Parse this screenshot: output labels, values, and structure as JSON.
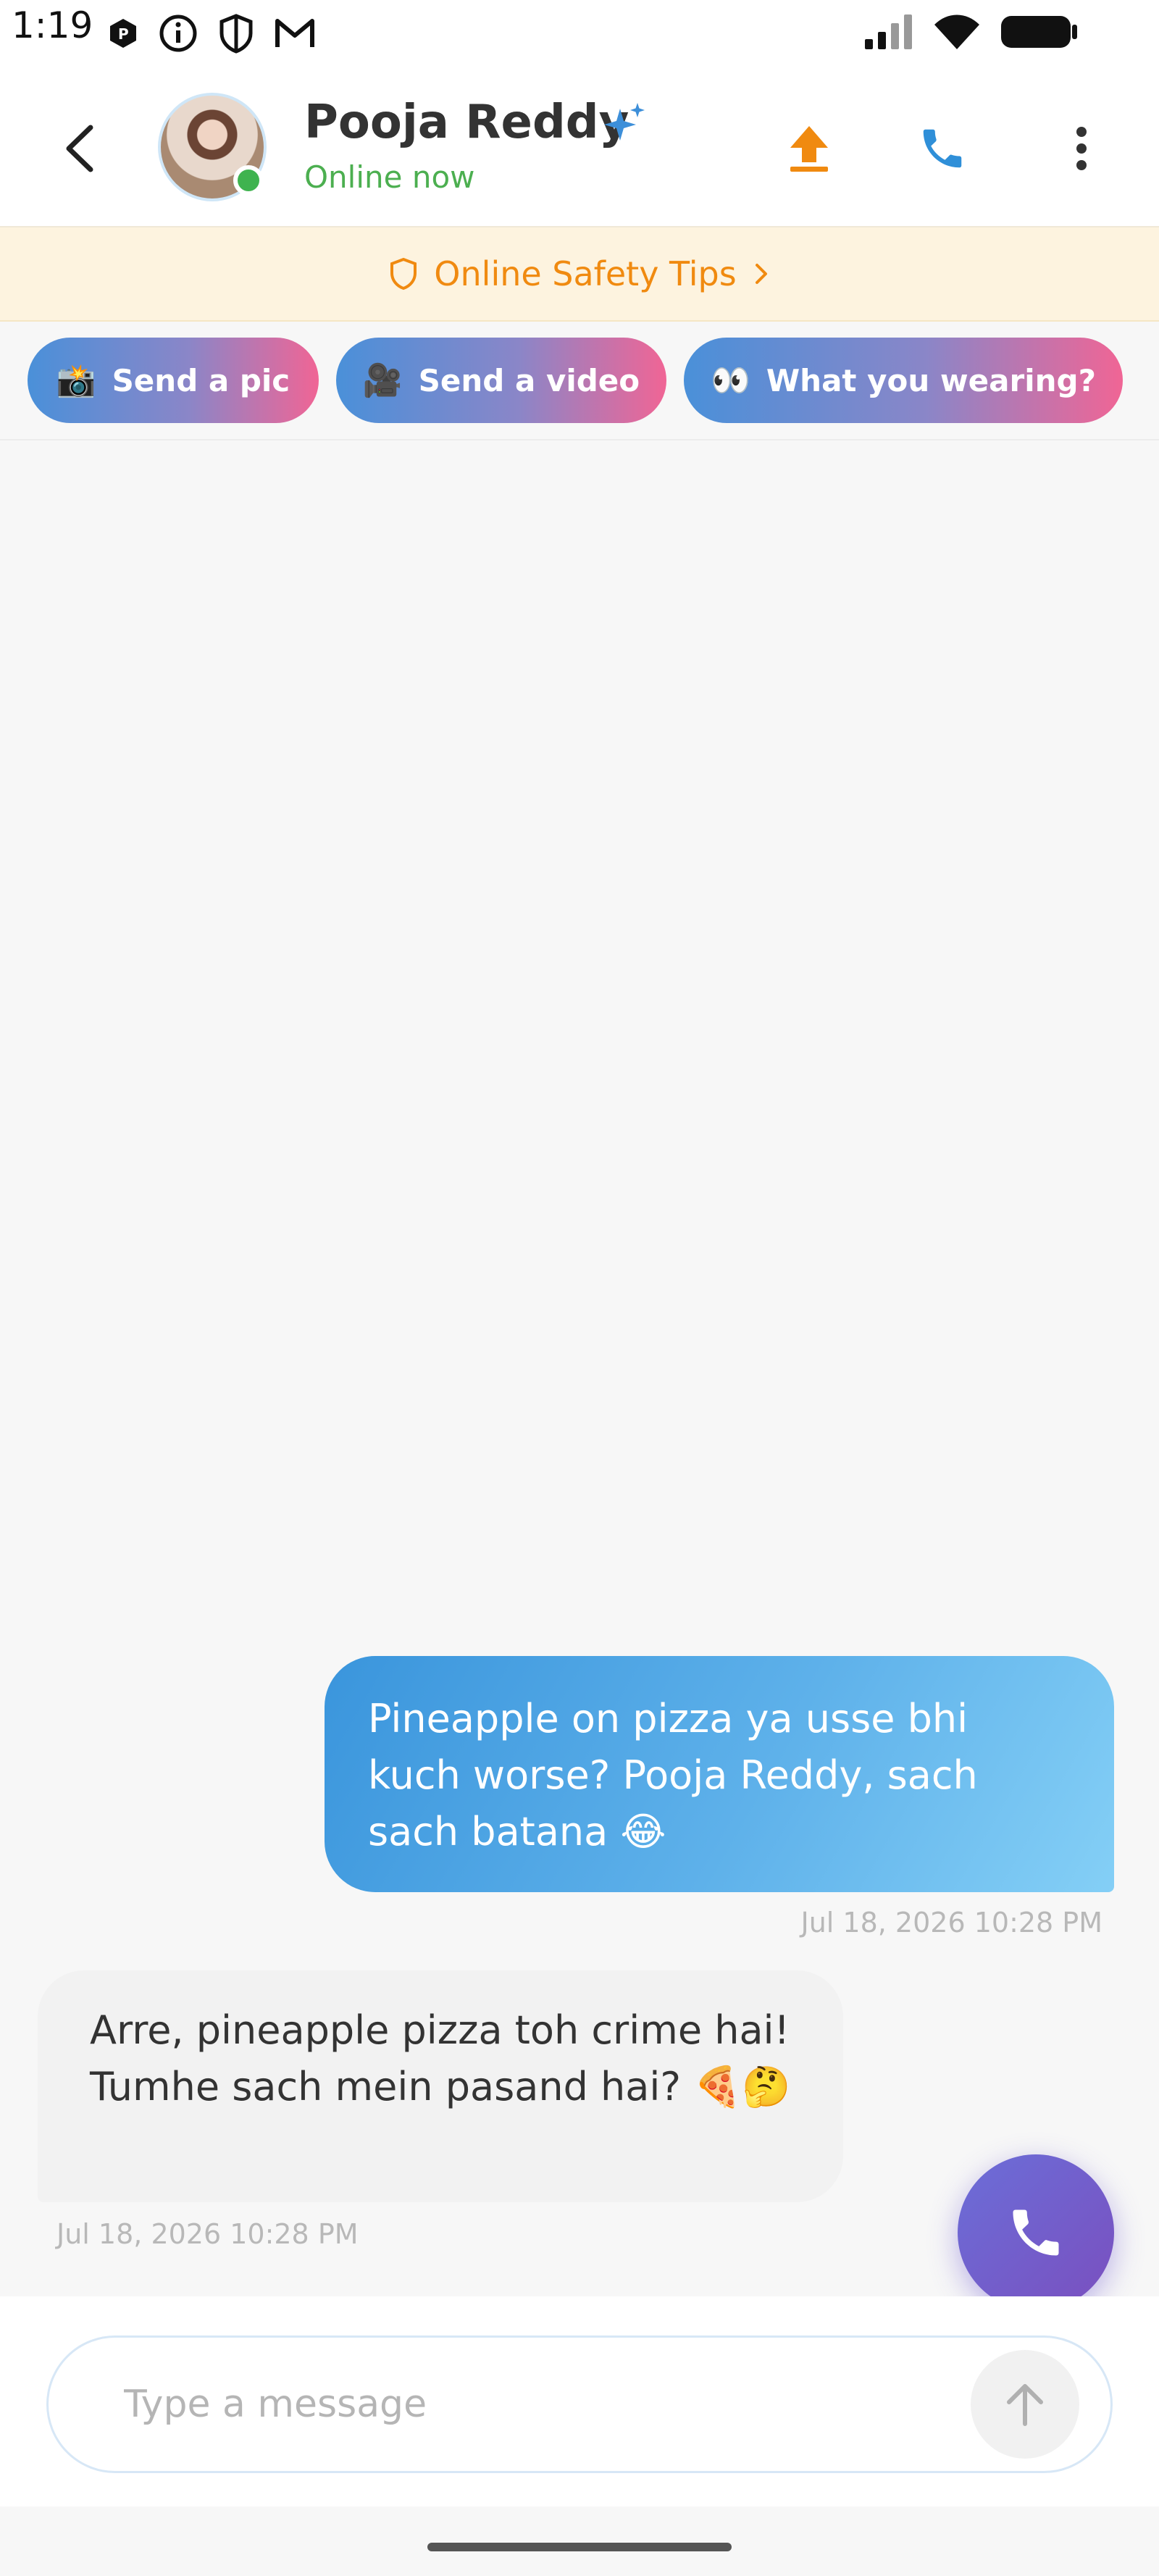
{
  "status_bar": {
    "time": "1:19",
    "left_icons": [
      "app-icon",
      "info-icon",
      "shield-icon",
      "gmail-icon"
    ],
    "right_icons": [
      "signal-icon",
      "wifi-icon",
      "battery-icon"
    ]
  },
  "header": {
    "contact_name": "Pooja Reddy",
    "status": "Online now",
    "icons": [
      "back-icon",
      "sparkle-icon",
      "upload-icon",
      "phone-icon",
      "more-vertical-icon"
    ],
    "colors": {
      "online": "#4caf50",
      "upload": "#f08a10",
      "call": "#2f8fd8"
    }
  },
  "safety_banner": {
    "label": "Online Safety Tips",
    "color": "#f08a10"
  },
  "quick_replies": [
    {
      "emoji": "📸",
      "label": "Send a pic"
    },
    {
      "emoji": "🎥",
      "label": "Send a video"
    },
    {
      "emoji": "👀",
      "label": "What you wearing?"
    }
  ],
  "messages": [
    {
      "direction": "sent",
      "text": "Pineapple on pizza ya usse bhi kuch worse? Pooja Reddy, sach sach batana 😂",
      "timestamp": "Jul 18, 2026 10:28 PM"
    },
    {
      "direction": "received",
      "text": "Arre, pineapple pizza toh crime hai! Tumhe sach mein pasand hai? 🍕🤔",
      "timestamp": "Jul 18, 2026 10:28 PM"
    }
  ],
  "composer": {
    "placeholder": "Type a message",
    "value": ""
  }
}
